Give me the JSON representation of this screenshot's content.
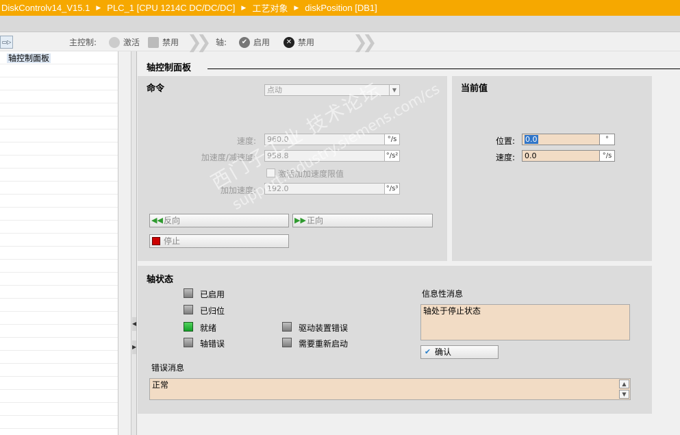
{
  "breadcrumb": [
    "DiskControlv14_V15.1",
    "PLC_1 [CPU 1214C DC/DC/DC]",
    "工艺对象",
    "diskPosition [DB1]"
  ],
  "toolbar": {
    "master_label": "主控制:",
    "activate_label": "激活",
    "disable_label": "禁用",
    "axis_label": "轴:",
    "enable_label": "启用",
    "axis_disable_label": "禁用"
  },
  "tree": {
    "item": "轴控制面板"
  },
  "panel": {
    "heading": "轴控制面板"
  },
  "command": {
    "title": "命令",
    "mode_value": "点动",
    "velocity_label": "速度:",
    "velocity_value": "960.0",
    "velocity_unit": "°/s",
    "accel_label": "加速度/减速度:",
    "accel_value": "958.8",
    "accel_unit": "°/s²",
    "jerk_enable_label": "激活加加速度限值",
    "jerk_label": "加加速度:",
    "jerk_value": "192.0",
    "jerk_unit": "°/s³",
    "backward_label": "反向",
    "forward_label": "正向",
    "stop_label": "停止"
  },
  "current": {
    "title": "当前值",
    "position_label": "位置:",
    "position_value": "0.0",
    "position_unit": "°",
    "velocity_label": "速度:",
    "velocity_value": "0.0",
    "velocity_unit": "°/s"
  },
  "status": {
    "title": "轴状态",
    "enabled": "已启用",
    "homed": "已归位",
    "ready": "就绪",
    "axis_error": "轴错误",
    "drive_error": "驱动装置错误",
    "restart_required": "需要重新启动",
    "info_label": "信息性消息",
    "info_text": "轴处于停止状态",
    "ack_label": "确认",
    "error_label": "错误消息",
    "error_text": "正常"
  },
  "watermark": {
    "line1": "西门子工业  技术论坛",
    "line2": "support.industry.siemens.com/cs"
  },
  "colors": {
    "title_bar": "#f6a800",
    "panel_bg": "#dcdcdc",
    "active_field": "#f2dcc5",
    "led_ready": "#14a028"
  }
}
